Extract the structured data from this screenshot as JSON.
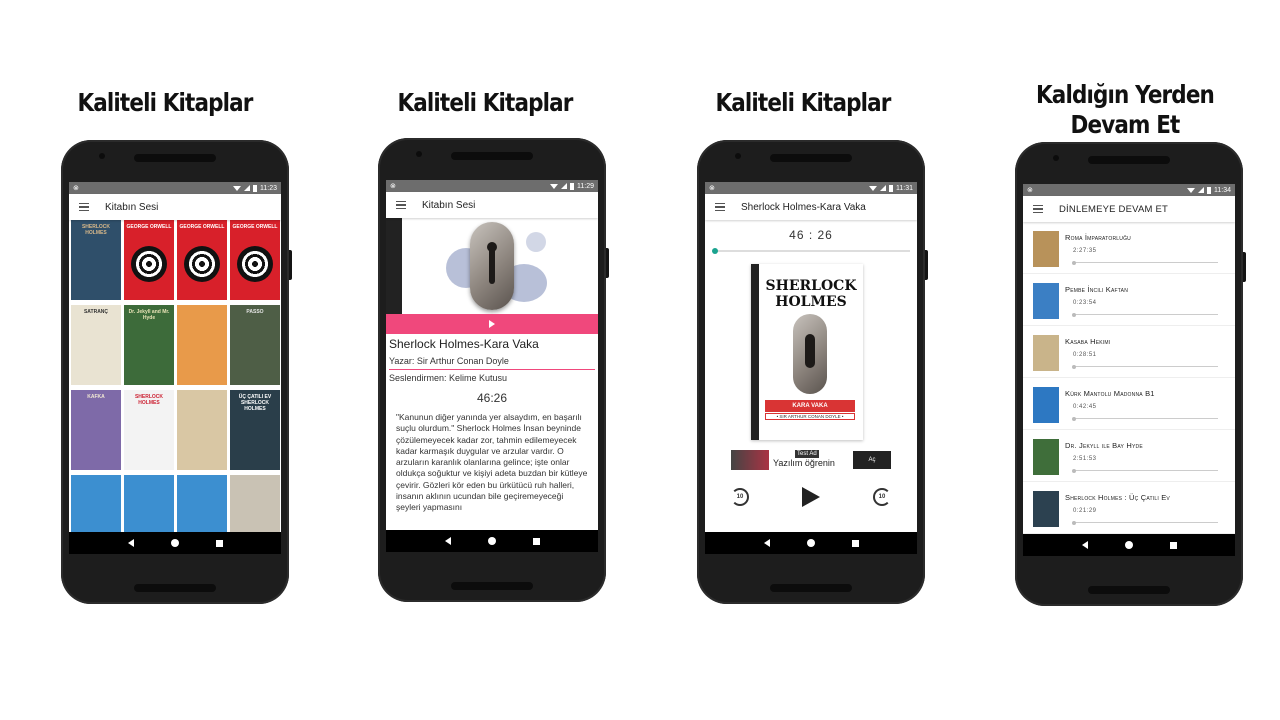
{
  "captions": [
    "Kaliteli Kitaplar",
    "Kaliteli Kitaplar",
    "Kaliteli Kitaplar",
    "Kaldığın Yerden Devam Et"
  ],
  "status_times": [
    "11:23",
    "11:29",
    "11:31",
    "11:34"
  ],
  "app_titles": [
    "Kitabın Sesi",
    "Kitabın Sesi",
    "Sherlock Holmes-Kara Vaka",
    "DİNLEMEYE DEVAM ET"
  ],
  "library": {
    "covers": [
      {
        "text": "SHERLOCK HOLMES",
        "bg": "#2f4f6a",
        "accent": "#d9b98a"
      },
      {
        "text": "GEORGE ORWELL",
        "bg": "#d8202a",
        "accent": "#ffffff"
      },
      {
        "text": "GEORGE ORWELL",
        "bg": "#d8202a",
        "accent": "#ffffff"
      },
      {
        "text": "GEORGE ORWELL",
        "bg": "#d8202a",
        "accent": "#ffffff"
      },
      {
        "text": "SATRANÇ",
        "bg": "#e9e3d2",
        "accent": "#333333"
      },
      {
        "text": "Dr. Jekyll and Mr. Hyde",
        "bg": "#3d6b3a",
        "accent": "#e8e2b6"
      },
      {
        "text": "",
        "bg": "#e89a4a",
        "accent": "#4a80c0"
      },
      {
        "text": "PASSO",
        "bg": "#4e5e46",
        "accent": "#e6e6e6"
      },
      {
        "text": "KAFKA",
        "bg": "#7e6aa8",
        "accent": "#f2e9d4"
      },
      {
        "text": "SHERLOCK HOLMES",
        "bg": "#f3f3f3",
        "accent": "#cc2233"
      },
      {
        "text": "",
        "bg": "#d9c7a4",
        "accent": "#7a5a3a"
      },
      {
        "text": "ÜÇ ÇATILI EV SHERLOCK HOLMES",
        "bg": "#2a3e4a",
        "accent": "#ffffff"
      },
      {
        "text": "",
        "bg": "#3c8fd0",
        "accent": "#ffffff"
      },
      {
        "text": "",
        "bg": "#3c8fd0",
        "accent": "#ffffff"
      },
      {
        "text": "",
        "bg": "#3c8fd0",
        "accent": "#ffffff"
      },
      {
        "text": "",
        "bg": "#c9c2b4",
        "accent": "#333333"
      }
    ]
  },
  "details": {
    "title": "Sherlock Holmes-Kara Vaka",
    "author": "Yazar: Sir Arthur Conan Doyle",
    "narrator": "Seslendirmen: Kelime Kutusu",
    "time": "46:26",
    "description": "\"Kanunun diğer yanında yer alsaydım, en başarılı suçlu olurdum.\" Sherlock Holmes İnsan beyninde çözülemeyecek kadar zor, tahmin edilemeyecek kadar karmaşık duygular ve arzular vardır. O arzuların karanlık olanlarına gelince; işte onlar oldukça soğuktur ve kişiyi adeta buzdan bir kütleye çevirir. Gözleri kör eden bu ürkütücü ruh halleri, insanın aklının ucundan bile geçiremeyeceği şeyleri yapmasını"
  },
  "player": {
    "time": "46 : 26",
    "progress": 0.0,
    "cover_title": "SHERLOCK HOLMES",
    "cover_band": "KARA VAKA",
    "cover_sub": "• SIR ARTHUR CONAN DOYLE •",
    "ad_badge": "Test Ad",
    "ad_text": "Yazılım öğrenin",
    "ad_button": "Aç",
    "rewind_label": "10",
    "forward_label": "10"
  },
  "continue_list": [
    {
      "title": "Roma İmparatorluğu",
      "duration": "2:27:35",
      "thumb": "#b8925a"
    },
    {
      "title": "Pembe İncili Kaftan",
      "duration": "0:23:54",
      "thumb": "#3b7fc4"
    },
    {
      "title": "Kasaba Hekimi",
      "duration": "0:28:51",
      "thumb": "#c9b48a"
    },
    {
      "title": "Kürk Mantolu Madonna B1",
      "duration": "0:42:45",
      "thumb": "#2d78c2"
    },
    {
      "title": "Dr. Jekyll ile Bay Hyde",
      "duration": "2:51:53",
      "thumb": "#3f6e3a"
    },
    {
      "title": "Sherlock Holmes : Üç Çatılı Ev",
      "duration": "0:21:29",
      "thumb": "#2c4150"
    }
  ]
}
